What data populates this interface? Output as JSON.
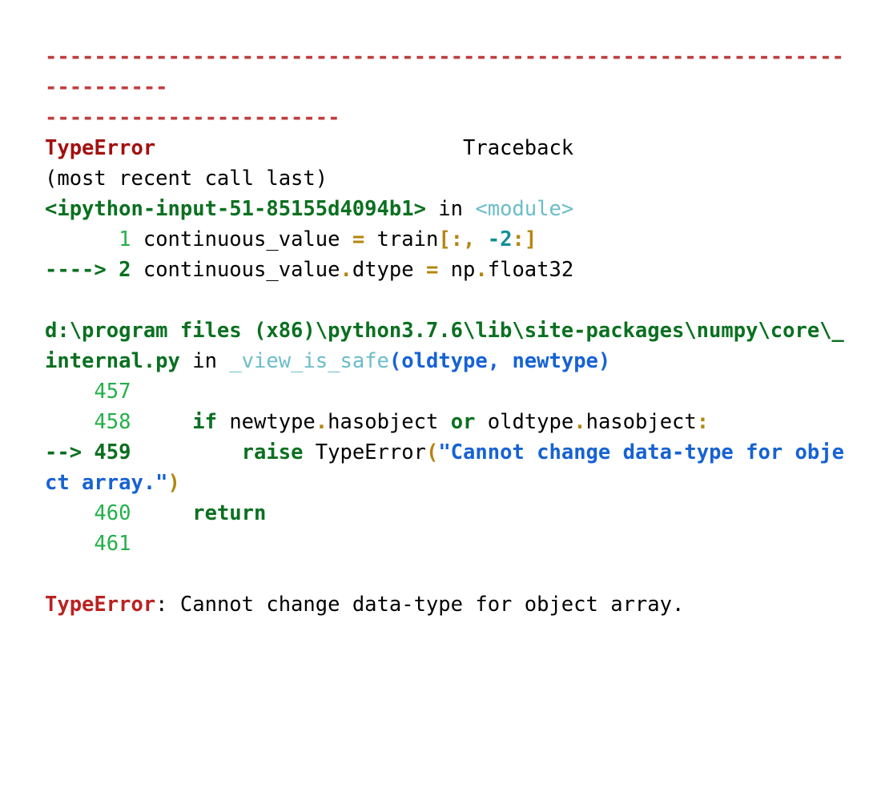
{
  "output": {
    "kind": "ipython-traceback",
    "exception_type": "TypeError",
    "exception_message": "Cannot change data-type for object array.",
    "traceback_label": "Traceback",
    "traceback_note": "(most recent call last)",
    "separator_long": "---------------------------------------------------------------------------",
    "in_keyword": "in",
    "frames": [
      {
        "file": "<ipython-input-51-85155d4094b1>",
        "function": "<module>",
        "lines": [
          {
            "lineno": "1",
            "current": false,
            "arrow": "",
            "code": "continuous_value = train[:, -2:]"
          },
          {
            "lineno": "2",
            "current": true,
            "arrow": "---->",
            "code": "continuous_value.dtype = np.float32"
          }
        ]
      },
      {
        "file": "d:\\program files (x86)\\python3.7.6\\lib\\site-packages\\numpy\\core\\_internal.py",
        "function": "_view_is_safe",
        "signature": "(oldtype, newtype)",
        "lines": [
          {
            "lineno": "457",
            "current": false,
            "arrow": "",
            "code": ""
          },
          {
            "lineno": "458",
            "current": false,
            "arrow": "",
            "code": "    if newtype.hasobject or oldtype.hasobject:"
          },
          {
            "lineno": "459",
            "current": true,
            "arrow": "-->",
            "code": "        raise TypeError(\"Cannot change data-type for object array.\")"
          },
          {
            "lineno": "460",
            "current": false,
            "arrow": "",
            "code": "        return"
          },
          {
            "lineno": "461",
            "current": false,
            "arrow": "",
            "code": ""
          }
        ]
      }
    ],
    "final_line": "TypeError: Cannot change data-type for object array.",
    "colors": {
      "separator": "#bf3f3f",
      "exception_name": "#a40f0f",
      "filename": "#0b7020",
      "function_name": "#6bbdc9",
      "arguments": "#1662d4",
      "line_number": "#23b04a",
      "line_number_current": "#0b7020",
      "keyword": "#0b7020",
      "operator": "#b58510",
      "number": "#108f99",
      "string": "#1662d4",
      "plain_text": "#000000",
      "background": "#ffffff"
    }
  },
  "segments": {
    "hr_1": "---------------------------------------------------------------------------",
    "hr_2": "------------------------",
    "typeerror_head": "TypeError",
    "traceback_word": "Traceback",
    "most_recent": "(most recent call last)",
    "frame1_file": "<ipython-input-51-85155d4094b1>",
    "in_word": "in",
    "frame1_func": "<module>",
    "f1_l1_no": "1",
    "f1_l1_a": "continuous_value ",
    "f1_l1_eq": "=",
    "f1_l1_b": " train",
    "f1_l1_br1": "[:, ",
    "f1_l1_num": "-2",
    "f1_l1_br2": ":]",
    "f1_l2_arrow": "---->",
    "f1_l2_no": "2",
    "f1_l2_a": "continuous_value",
    "f1_l2_dot": ".",
    "f1_l2_b": "dtype ",
    "f1_l2_eq": "=",
    "f1_l2_c": " np",
    "f1_l2_dot2": ".",
    "f1_l2_d": "float32",
    "frame2_file_1": "d:\\program files (x86)\\python3.7.6\\lib\\site-packages",
    "frame2_file_2": "\\numpy\\core\\_internal.py",
    "frame2_func": "_view_is_safe",
    "frame2_sig": "(oldtype, newtype)",
    "f2_l457_no": "457",
    "f2_l458_no": "458",
    "f2_l458_if": "if",
    "f2_l458_a": " newtype",
    "f2_l458_dot1": ".",
    "f2_l458_b": "hasobject ",
    "f2_l458_or": "or",
    "f2_l458_c": " oldtype",
    "f2_l458_dot2": ".",
    "f2_l458_d": "hasobject",
    "f2_l458_colon": ":",
    "f2_l459_arrow": "-->",
    "f2_l459_no": "459",
    "f2_l459_raise": "raise",
    "f2_l459_a": " TypeError",
    "f2_l459_paren1": "(",
    "f2_l459_str": "\"Cannot change data-type for object array.\"",
    "f2_l459_paren2": ")",
    "f2_l460_no": "460",
    "f2_l460_return": "return",
    "f2_l461_no": "461",
    "final_name": "TypeError",
    "final_sep": ": ",
    "final_msg": "Cannot change data-type for object array."
  }
}
